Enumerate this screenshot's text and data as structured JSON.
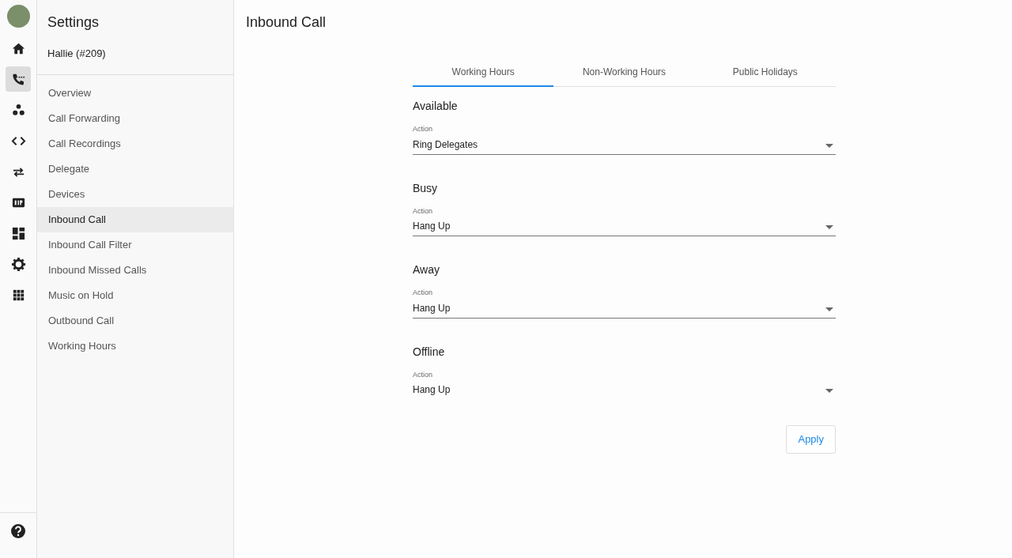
{
  "rail": {
    "items": [
      {
        "kind": "home",
        "selected": false
      },
      {
        "kind": "phone",
        "selected": true
      },
      {
        "kind": "people",
        "selected": false
      },
      {
        "kind": "code",
        "selected": false
      },
      {
        "kind": "swap",
        "selected": false
      },
      {
        "kind": "sip",
        "selected": false
      },
      {
        "kind": "dashboard",
        "selected": false
      },
      {
        "kind": "gear",
        "selected": false
      },
      {
        "kind": "apps",
        "selected": false
      }
    ]
  },
  "sidebar": {
    "title": "Settings",
    "subtitle": "Hallie (#209)",
    "items": [
      {
        "label": "Overview",
        "selected": false
      },
      {
        "label": "Call Forwarding",
        "selected": false
      },
      {
        "label": "Call Recordings",
        "selected": false
      },
      {
        "label": "Delegate",
        "selected": false
      },
      {
        "label": "Devices",
        "selected": false
      },
      {
        "label": "Inbound Call",
        "selected": true
      },
      {
        "label": "Inbound Call Filter",
        "selected": false
      },
      {
        "label": "Inbound Missed Calls",
        "selected": false
      },
      {
        "label": "Music on Hold",
        "selected": false
      },
      {
        "label": "Outbound Call",
        "selected": false
      },
      {
        "label": "Working Hours",
        "selected": false
      }
    ]
  },
  "page": {
    "title": "Inbound Call"
  },
  "tabs": [
    {
      "label": "Working Hours",
      "selected": true
    },
    {
      "label": "Non-Working Hours",
      "selected": false
    },
    {
      "label": "Public Holidays",
      "selected": false
    }
  ],
  "sections": [
    {
      "heading": "Available",
      "label": "Action",
      "value": "Ring Delegates",
      "underlined": true
    },
    {
      "heading": "Busy",
      "label": "Action",
      "value": "Hang Up",
      "underlined": true
    },
    {
      "heading": "Away",
      "label": "Action",
      "value": "Hang Up",
      "underlined": true
    },
    {
      "heading": "Offline",
      "label": "Action",
      "value": "Hang Up",
      "underlined": false
    }
  ],
  "apply_button": "Apply"
}
